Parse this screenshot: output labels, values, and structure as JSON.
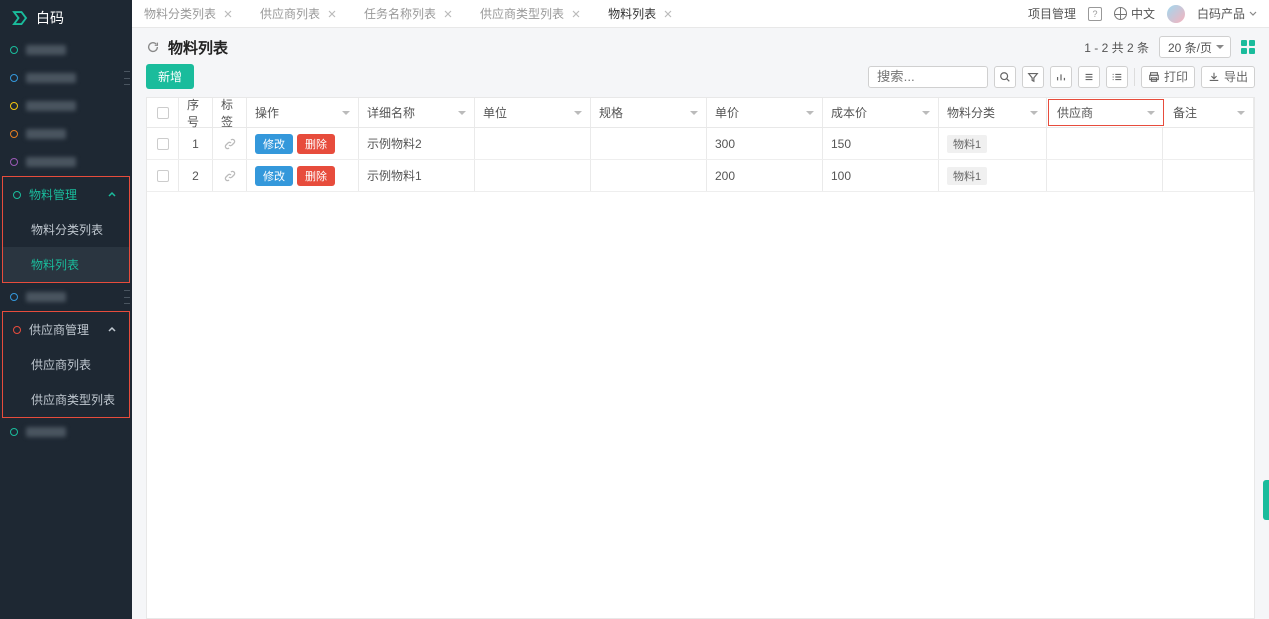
{
  "brand": "白码",
  "sidebar": {
    "group1": {
      "label": "物料管理",
      "items": [
        "物料分类列表",
        "物料列表"
      ],
      "active_index": 1
    },
    "group2": {
      "label": "供应商管理",
      "items": [
        "供应商列表",
        "供应商类型列表"
      ]
    }
  },
  "tabs": [
    "物料分类列表",
    "供应商列表",
    "任务名称列表",
    "供应商类型列表",
    "物料列表"
  ],
  "tabs_active_index": 4,
  "top_right": {
    "proj_mgmt": "项目管理",
    "lang": "中文",
    "user": "白码产品"
  },
  "page": {
    "title": "物料列表",
    "new_btn": "新增",
    "pagination": "1 - 2 共 2 条",
    "page_size": "20 条/页",
    "search_placeholder": "搜索...",
    "print": "打印",
    "export": "导出"
  },
  "table": {
    "headers": {
      "idx": "序号",
      "tag": "标签",
      "op": "操作",
      "name": "详细名称",
      "unit": "单位",
      "spec": "规格",
      "price": "单价",
      "cost": "成本价",
      "cat": "物料分类",
      "supplier": "供应商",
      "note": "备注"
    },
    "btn_edit": "修改",
    "btn_del": "删除",
    "rows": [
      {
        "idx": "1",
        "name": "示例物料2",
        "unit": "",
        "spec": "",
        "price": "300",
        "cost": "150",
        "cat": "物料1",
        "supplier": "",
        "note": ""
      },
      {
        "idx": "2",
        "name": "示例物料1",
        "unit": "",
        "spec": "",
        "price": "200",
        "cost": "100",
        "cat": "物料1",
        "supplier": "",
        "note": ""
      }
    ]
  }
}
